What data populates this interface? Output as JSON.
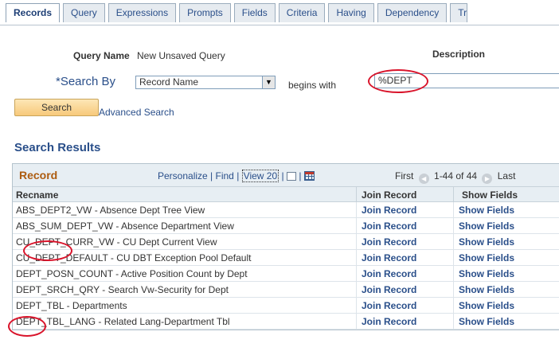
{
  "tabs": [
    {
      "label": "Records",
      "active": true
    },
    {
      "label": "Query",
      "active": false
    },
    {
      "label": "Expressions",
      "active": false
    },
    {
      "label": "Prompts",
      "active": false
    },
    {
      "label": "Fields",
      "active": false
    },
    {
      "label": "Criteria",
      "active": false
    },
    {
      "label": "Having",
      "active": false
    },
    {
      "label": "Dependency",
      "active": false
    },
    {
      "label": "Tr",
      "active": false
    }
  ],
  "form": {
    "query_name_label": "Query Name",
    "query_name_value": "New Unsaved Query",
    "description_label": "Description",
    "search_by_label": "*Search By",
    "search_by_value": "Record Name",
    "operator_label": "begins with",
    "search_value": "%DEPT",
    "search_button": "Search",
    "advanced_search_link": "Advanced Search"
  },
  "results": {
    "section_title": "Search Results",
    "grid_title": "Record",
    "personalize": "Personalize",
    "find": "Find",
    "view": "View 20",
    "sep": "|",
    "first": "First",
    "range": "1-44 of 44",
    "last": "Last",
    "columns": [
      "Recname",
      "Join Record",
      "Show Fields"
    ],
    "rows": [
      {
        "recname": "ABS_DEPT2_VW - Absence Dept Tree View",
        "join": "Join Record",
        "show": "Show Fields"
      },
      {
        "recname": "ABS_SUM_DEPT_VW - Absence Department View",
        "join": "Join Record",
        "show": "Show Fields"
      },
      {
        "recname": "CU_DEPT_CURR_VW - CU Dept Current View",
        "join": "Join Record",
        "show": "Show Fields"
      },
      {
        "recname": "CU_DEPT_DEFAULT - CU DBT Exception Pool Default",
        "join": "Join Record",
        "show": "Show Fields"
      },
      {
        "recname": "DEPT_POSN_COUNT - Active Position Count by Dept",
        "join": "Join Record",
        "show": "Show Fields"
      },
      {
        "recname": "DEPT_SRCH_QRY - Search Vw-Security for Dept",
        "join": "Join Record",
        "show": "Show Fields"
      },
      {
        "recname": "DEPT_TBL - Departments",
        "join": "Join Record",
        "show": "Show Fields"
      },
      {
        "recname": "DEPT_TBL_LANG - Related Lang-Department Tbl",
        "join": "Join Record",
        "show": "Show Fields"
      }
    ]
  },
  "icons": {
    "dropdown": "chevron-down-icon",
    "new_window": "new-window-icon",
    "download": "download-grid-icon",
    "prev": "prev-arrow-icon",
    "next": "next-arrow-icon"
  },
  "colors": {
    "annotation": "#d9142b",
    "link": "#2a4f8a",
    "grid_title": "#ad5c10",
    "button": "#f7c97a"
  }
}
